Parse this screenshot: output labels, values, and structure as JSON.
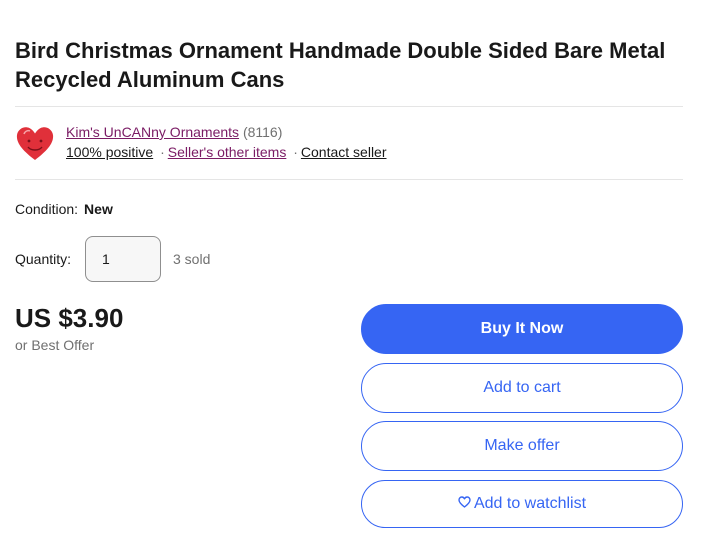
{
  "listing": {
    "title": "Bird Christmas Ornament Handmade Double Sided Bare Metal Recycled Aluminum Cans"
  },
  "seller": {
    "name": "Kim's UnCANny Ornaments",
    "feedback_count": "(8116)",
    "positive": "100% positive",
    "other_items": "Seller's other items",
    "contact": "Contact seller",
    "separator": "·",
    "avatar_icon": "red-heart-avatar"
  },
  "condition": {
    "label": "Condition:",
    "value": "New"
  },
  "quantity": {
    "label": "Quantity:",
    "value": "1",
    "sold": "3 sold"
  },
  "price": {
    "amount": "US $3.90",
    "best_offer": "or Best Offer"
  },
  "actions": {
    "buy_now": "Buy It Now",
    "add_to_cart": "Add to cart",
    "make_offer": "Make offer",
    "add_to_watchlist": "Add to watchlist"
  },
  "colors": {
    "primary": "#3665f3",
    "seller_link": "#7a1b64",
    "avatar_red": "#e0303a"
  }
}
